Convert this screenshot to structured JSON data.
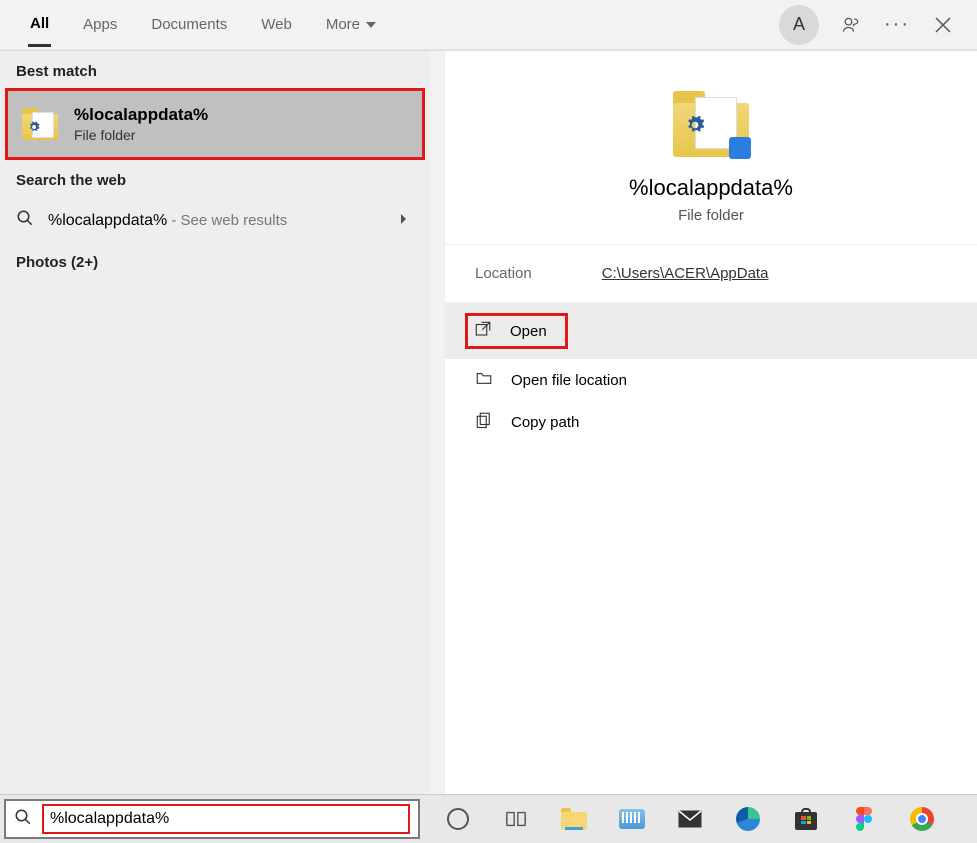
{
  "header": {
    "tabs": [
      "All",
      "Apps",
      "Documents",
      "Web",
      "More"
    ],
    "selected_tab_index": 0,
    "avatar_initial": "A"
  },
  "left": {
    "best_match_label": "Best match",
    "best_match": {
      "title": "%localappdata%",
      "subtitle": "File folder"
    },
    "search_web_label": "Search the web",
    "web_query": "%localappdata%",
    "web_hint": " - See web results",
    "photos_label": "Photos (2+)"
  },
  "preview": {
    "title": "%localappdata%",
    "subtitle": "File folder",
    "location_label": "Location",
    "location_path": "C:\\Users\\ACER\\AppData",
    "actions": {
      "open": "Open",
      "open_file_location": "Open file location",
      "copy_path": "Copy path"
    }
  },
  "search": {
    "value": "%localappdata%"
  },
  "taskbar_icons": [
    "cortana",
    "task-view",
    "file-explorer",
    "keyboard",
    "mail",
    "edge",
    "store",
    "figma",
    "chrome"
  ]
}
